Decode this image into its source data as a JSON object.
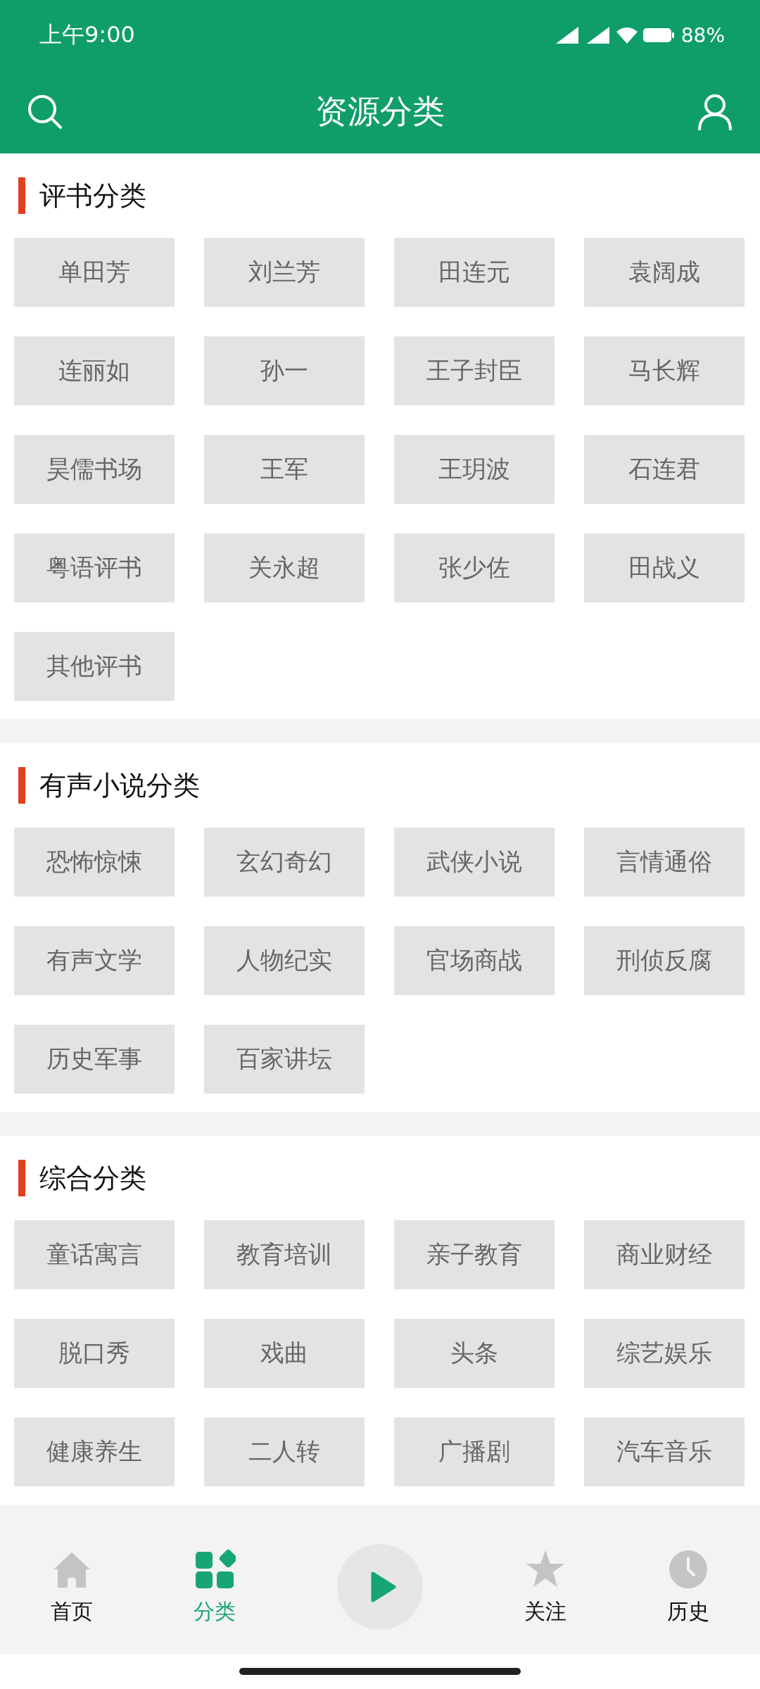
{
  "status_bar": {
    "time": "上午9:00",
    "battery": "88%"
  },
  "header": {
    "title": "资源分类"
  },
  "sections": [
    {
      "title": "评书分类",
      "items": [
        "单田芳",
        "刘兰芳",
        "田连元",
        "袁阔成",
        "连丽如",
        "孙一",
        "王子封臣",
        "马长辉",
        "昊儒书场",
        "王军",
        "王玥波",
        "石连君",
        "粤语评书",
        "关永超",
        "张少佐",
        "田战义",
        "其他评书"
      ]
    },
    {
      "title": "有声小说分类",
      "items": [
        "恐怖惊悚",
        "玄幻奇幻",
        "武侠小说",
        "言情通俗",
        "有声文学",
        "人物纪实",
        "官场商战",
        "刑侦反腐",
        "历史军事",
        "百家讲坛"
      ]
    },
    {
      "title": "综合分类",
      "items": [
        "童话寓言",
        "教育培训",
        "亲子教育",
        "商业财经",
        "脱口秀",
        "戏曲",
        "头条",
        "综艺娱乐",
        "健康养生",
        "二人转",
        "广播剧",
        "汽车音乐"
      ]
    }
  ],
  "bottom_nav": [
    {
      "kind": "home",
      "label": "首页",
      "selected": false
    },
    {
      "kind": "category",
      "label": "分类",
      "selected": true
    },
    {
      "kind": "play"
    },
    {
      "kind": "star",
      "label": "关注",
      "selected": false
    },
    {
      "kind": "history",
      "label": "历史",
      "selected": false
    }
  ]
}
